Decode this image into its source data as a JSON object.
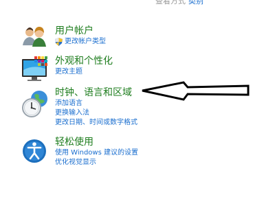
{
  "top_cut": {
    "text": "查看方式",
    "link": "类别"
  },
  "categories": [
    {
      "id": "user-accounts",
      "icon": "users-icon",
      "title": "用户帐户",
      "links": [
        "更改帐户类型"
      ]
    },
    {
      "id": "appearance",
      "icon": "monitor-palette-icon",
      "title": "外观和个性化",
      "links": [
        "更改主题"
      ]
    },
    {
      "id": "clock-region",
      "icon": "clock-globe-icon",
      "title": "时钟、语言和区域",
      "links": [
        "添加语言",
        "更换输入法",
        "更改日期、时间或数字格式"
      ]
    },
    {
      "id": "ease-of-access",
      "icon": "ease-of-access-icon",
      "title": "轻松使用",
      "links": [
        "使用 Windows 建议的设置",
        "优化视觉显示"
      ]
    }
  ],
  "colors": {
    "title": "#1e7d1e",
    "link": "#1a6ecf",
    "arrow": "#000000"
  }
}
